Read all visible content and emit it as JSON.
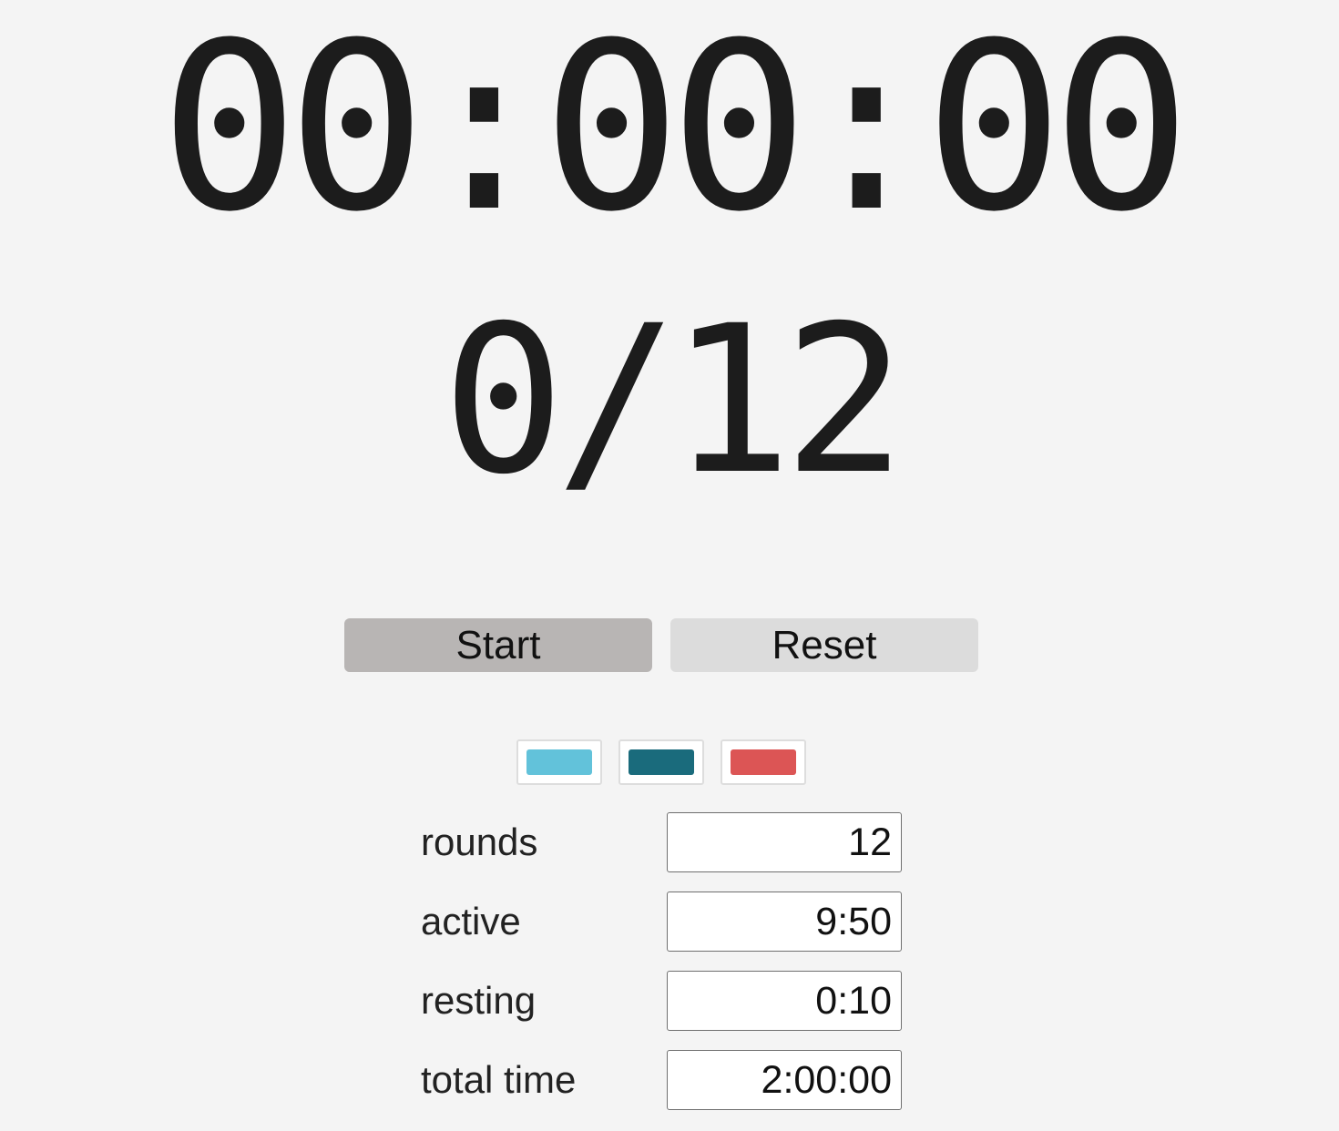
{
  "timer": {
    "clock": "00:00:00",
    "round_progress": "0/12"
  },
  "controls": {
    "start_label": "Start",
    "reset_label": "Reset"
  },
  "themes": {
    "colors": [
      "#62c2da",
      "#1a6b7c",
      "#dc5555"
    ]
  },
  "settings": {
    "rounds": {
      "label": "rounds",
      "value": "12"
    },
    "active": {
      "label": "active",
      "value": "9:50"
    },
    "resting": {
      "label": "resting",
      "value": "0:10"
    },
    "total_time": {
      "label": "total time",
      "value": "2:00:00"
    }
  }
}
